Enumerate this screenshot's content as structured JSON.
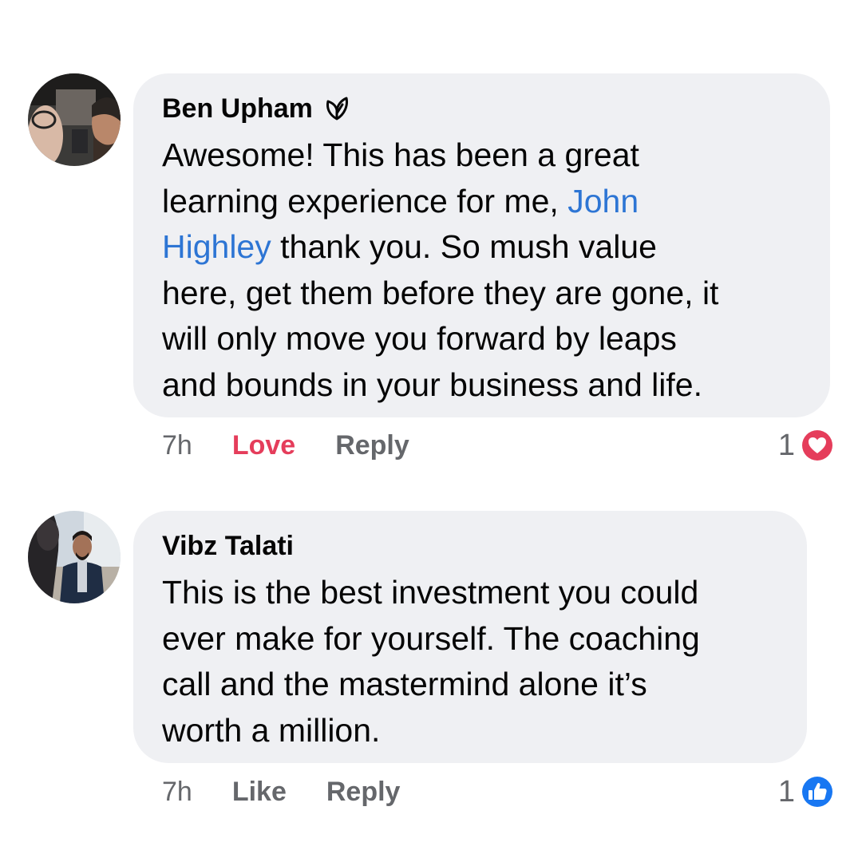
{
  "comments": [
    {
      "author": "Ben Upham",
      "badge_icon": "top-fan-leaf-icon",
      "text_lines": [
        [
          "Awesome! This has been a great"
        ],
        [
          "learning experience for me, ",
          "John"
        ],
        [
          "Highley",
          " thank you. So mush value"
        ],
        [
          "here, get them before they are gone, it"
        ],
        [
          "will only move you forward by leaps"
        ],
        [
          "and bounds in your business and life."
        ]
      ],
      "mention": "John Highley",
      "time": "7h",
      "reaction_action": "Love",
      "reply": "Reply",
      "reaction_count": "1",
      "reaction_icon": "love-heart-icon",
      "reaction_color": "#e53d5b"
    },
    {
      "author": "Vibz Talati",
      "text_lines": [
        [
          "This is the best investment you could"
        ],
        [
          "ever make for yourself. The coaching"
        ],
        [
          "call and the mastermind alone it’s"
        ],
        [
          "worth a million."
        ]
      ],
      "time": "7h",
      "reaction_action": "Like",
      "reply": "Reply",
      "reaction_count": "1",
      "reaction_icon": "like-thumb-icon",
      "reaction_color": "#1877f2"
    }
  ],
  "colors": {
    "bubble": "#eff0f3",
    "mention": "#2d75d4",
    "meta_text": "#65676b"
  }
}
